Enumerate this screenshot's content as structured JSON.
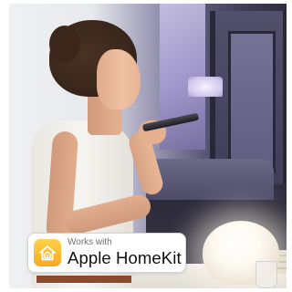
{
  "badge": {
    "small_text": "Works with",
    "big_text": "Apple HomeKit",
    "icon": "homekit-house-icon",
    "icon_color": "#f6b02a"
  },
  "scene": {
    "subject": "woman-speaking-into-phone",
    "lamp": "glowing-orb-lamp"
  },
  "colors": {
    "background": "#ffffff",
    "room_accent": "#8a82c2",
    "lamp_glow": "#fdf9f0"
  }
}
